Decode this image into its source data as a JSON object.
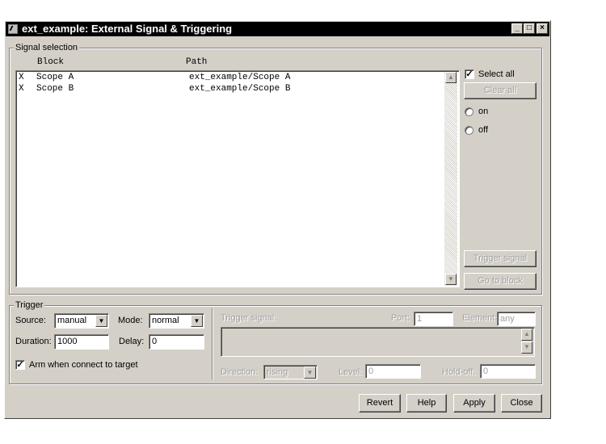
{
  "window": {
    "title": "ext_example: External Signal & Triggering",
    "controls": [
      "minimize-icon",
      "maximize-icon",
      "close-icon"
    ]
  },
  "signal_selection": {
    "label": "Signal selection",
    "columns": [
      "Block",
      "Path"
    ],
    "rows": [
      {
        "mark": "X",
        "block": "Scope A",
        "path": "ext_example/Scope A"
      },
      {
        "mark": "X",
        "block": "Scope B",
        "path": "ext_example/Scope B"
      }
    ],
    "select_all_label": "Select all",
    "select_all_checked": true,
    "clear_all_label": "Clear all",
    "on_label": "on",
    "off_label": "off",
    "trigger_signal_button": "Trigger signal",
    "go_to_block_button": "Go to block"
  },
  "trigger": {
    "label": "Trigger",
    "source_label": "Source:",
    "source_value": "manual",
    "mode_label": "Mode:",
    "mode_value": "normal",
    "duration_label": "Duration:",
    "duration_value": "1000",
    "delay_label": "Delay:",
    "delay_value": "0",
    "arm_label": "Arm when connect to target",
    "arm_checked": true,
    "trigger_signal_label": "Trigger signal:",
    "port_label": "Port:",
    "port_value": "1",
    "element_label": "Element:",
    "element_value": "any",
    "direction_label": "Direction:",
    "direction_value": "rising",
    "level_label": "Level:",
    "level_value": "0",
    "holdoff_label": "Hold-off:",
    "holdoff_value": "0"
  },
  "footer": {
    "revert": "Revert",
    "help": "Help",
    "apply": "Apply",
    "close": "Close"
  }
}
